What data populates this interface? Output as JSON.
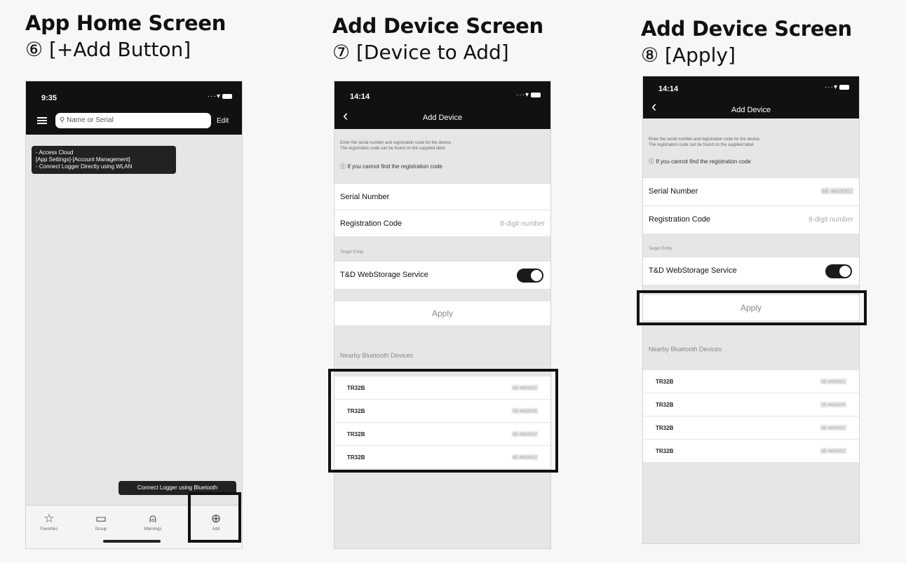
{
  "panels": [
    {
      "title": "App Home Screen",
      "subtitle": "⑥ [+Add Button]"
    },
    {
      "title": "Add Device Screen",
      "subtitle": "⑦ [Device to Add]"
    },
    {
      "title": "Add Device Screen",
      "subtitle": "⑧ [Apply]"
    }
  ],
  "home": {
    "time": "9:35",
    "search_placeholder": "Name or Serial",
    "edit_label": "Edit",
    "tooltip_cloud": "- Access Cloud\n[App Settings]-[Account Management]\n- Connect Logger Directly using WLAN",
    "tooltip_bt": "Connect Logger using Bluetooth",
    "tabs": [
      {
        "label": "Favorites",
        "icon": "star-icon"
      },
      {
        "label": "Group",
        "icon": "folder-icon"
      },
      {
        "label": "Warnings",
        "icon": "bell-icon"
      },
      {
        "label": "Add",
        "icon": "plus-circle-icon"
      }
    ]
  },
  "add_device": {
    "time": "14:14",
    "title": "Add Device",
    "description": "Enter the serial number and registration code for the device.\nThe registration code can be found on the supplied label.",
    "help_link": "ⓘ If you cannot find the registration code",
    "serial_label": "Serial Number",
    "serial_value": "6E460002",
    "reg_label": "Registration Code",
    "reg_placeholder": "8-digit number",
    "target_label": "Target Entity",
    "service_label": "T&D WebStorage Service",
    "service_enabled": true,
    "apply_label": "Apply",
    "nearby_label": "Nearby Bluetooth Devices",
    "devices": [
      {
        "name": "TR32B",
        "serial": "6E460002"
      },
      {
        "name": "TR32B",
        "serial": "5E460005"
      },
      {
        "name": "TR32B",
        "serial": "6E460002"
      },
      {
        "name": "TR32B",
        "serial": "6E460002"
      }
    ]
  }
}
